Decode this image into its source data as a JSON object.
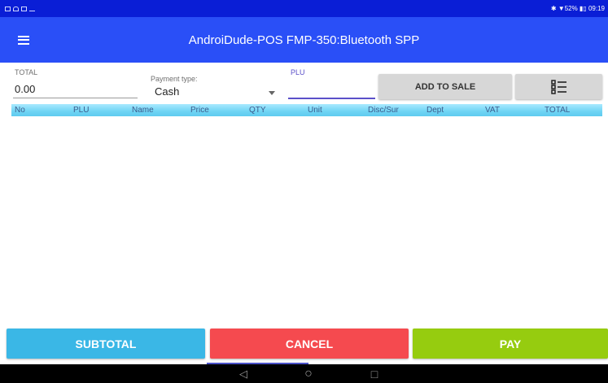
{
  "status_bar": {
    "right_text": "✱ ▼52% ▮▯ 09:19",
    "icons": [
      "notification-icon",
      "cloud-icon",
      "image-icon",
      "upload-icon"
    ]
  },
  "app_bar": {
    "title": "AndroiDude-POS   FMP-350:Bluetooth SPP",
    "color": "#2a4ff7"
  },
  "form": {
    "total_label": "TOTAL",
    "total_value": "0.00",
    "payment_label": "Payment type:",
    "payment_value": "Cash",
    "plu_label": "PLU",
    "plu_value": "",
    "add_button": "ADD TO SALE"
  },
  "table": {
    "columns": [
      "No",
      "PLU",
      "Name",
      "Price",
      "QTY",
      "Unit",
      "Disc/Sur",
      "Dept",
      "VAT",
      "TOTAL"
    ],
    "rows": []
  },
  "actions": {
    "subtotal": "SUBTOTAL",
    "cancel": "CANCEL",
    "pay": "PAY"
  },
  "nav": {
    "back": "◁",
    "home": "○",
    "recents": "□"
  }
}
